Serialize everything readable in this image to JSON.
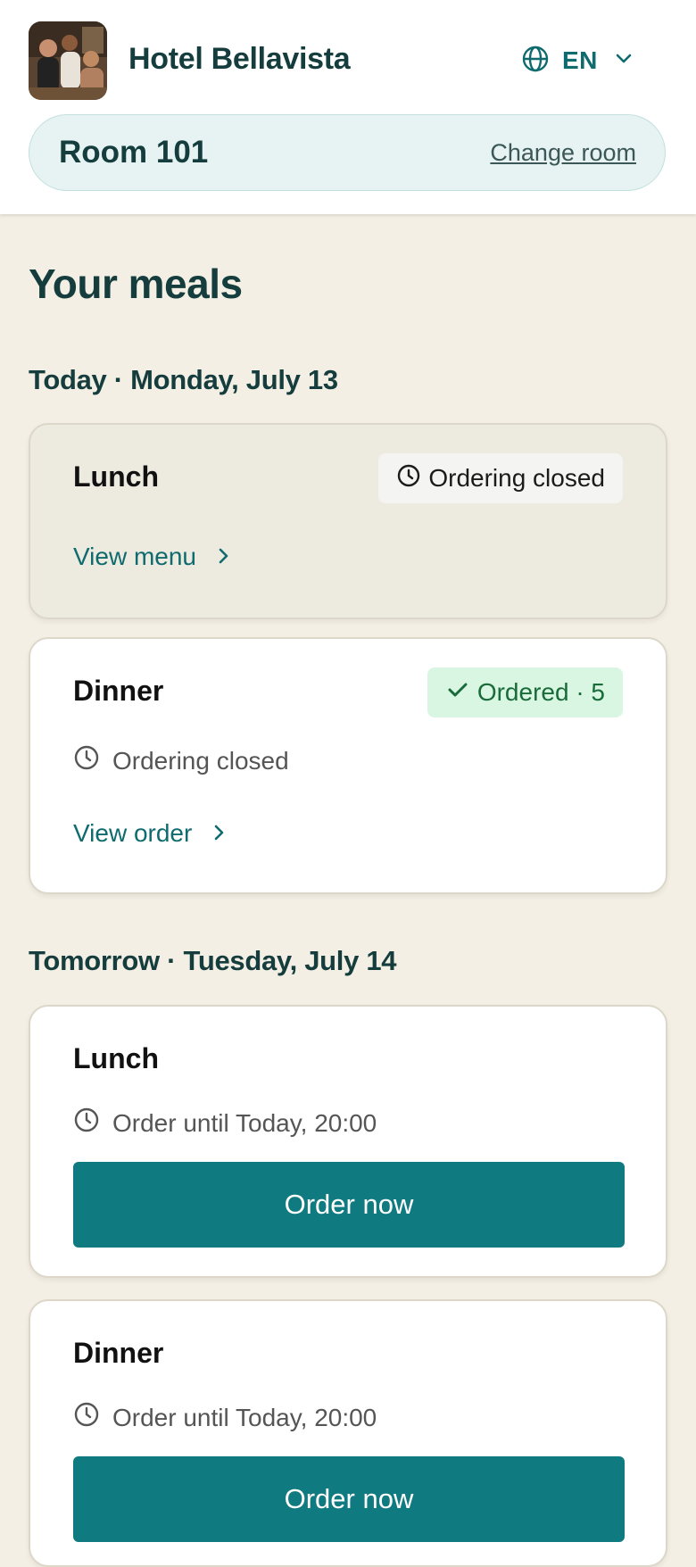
{
  "header": {
    "hotel_name": "Hotel Bellavista",
    "language_code": "EN",
    "room_label": "Room 101",
    "change_room_label": "Change room"
  },
  "page_title": "Your meals",
  "days": [
    {
      "heading": "Today · Monday, July 13",
      "meals": [
        {
          "name": "Lunch",
          "badge": "Ordering closed",
          "link": "View menu"
        },
        {
          "name": "Dinner",
          "badge": "Ordered · 5",
          "status": "Ordering closed",
          "link": "View order"
        }
      ]
    },
    {
      "heading": "Tomorrow · Tuesday, July 14",
      "meals": [
        {
          "name": "Lunch",
          "status": "Order until Today, 20:00",
          "button": "Order now"
        },
        {
          "name": "Dinner",
          "status": "Order until Today, 20:00",
          "button": "Order now"
        }
      ]
    }
  ],
  "colors": {
    "accent": "#0f7a80",
    "link": "#0f6b6e",
    "background": "#f3efe4",
    "ordered_badge_bg": "#d8f6e2",
    "ordered_badge_text": "#1a6b3a"
  },
  "icons": [
    "hotel-photo",
    "globe-icon",
    "chevron-down-icon",
    "clock-icon",
    "check-icon",
    "chevron-right-icon"
  ]
}
